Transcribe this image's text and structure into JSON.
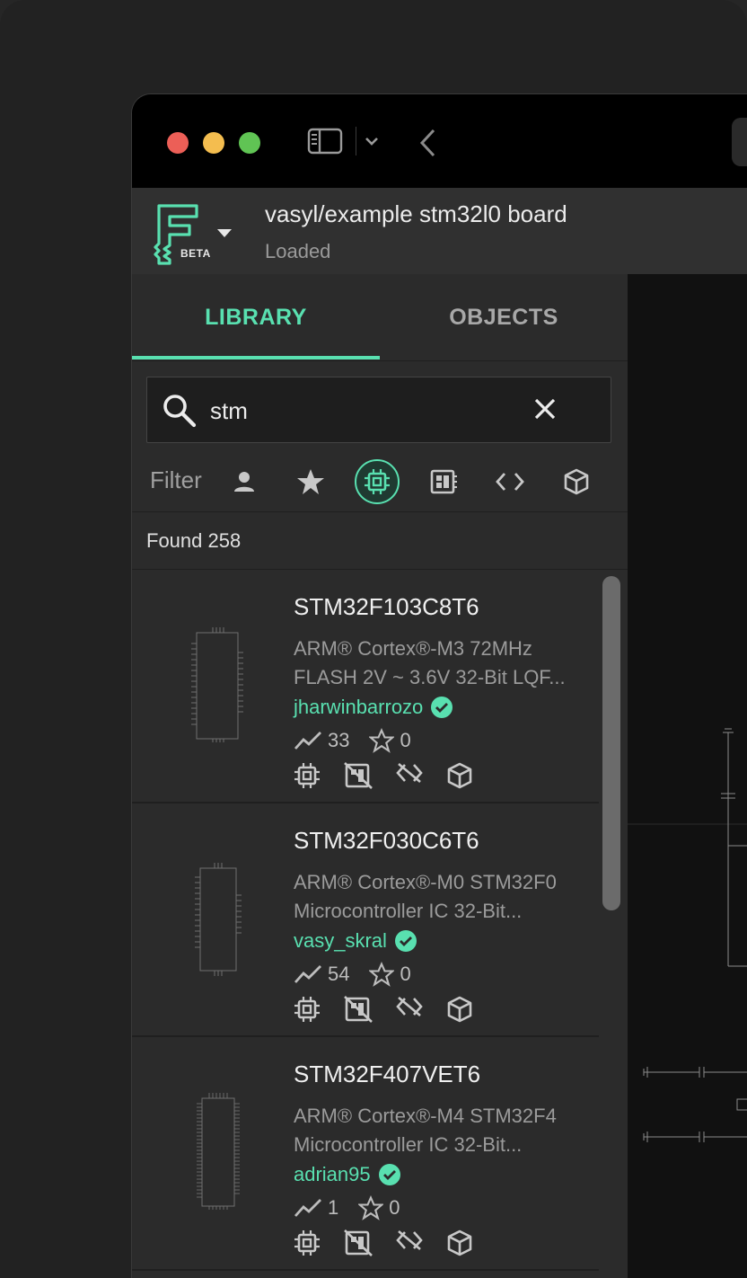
{
  "app": {
    "logo_badge": "BETA",
    "document_title": "vasyl/example stm32l0 board",
    "document_status": "Loaded"
  },
  "tabs": [
    {
      "label": "LIBRARY",
      "active": true
    },
    {
      "label": "OBJECTS",
      "active": false
    }
  ],
  "search": {
    "value": "stm",
    "placeholder": ""
  },
  "filter": {
    "label": "Filter",
    "buttons": [
      {
        "icon": "person-icon",
        "active": false
      },
      {
        "icon": "star-icon",
        "active": false
      },
      {
        "icon": "chip-icon",
        "active": true
      },
      {
        "icon": "board-icon",
        "active": false
      },
      {
        "icon": "code-icon",
        "active": false
      },
      {
        "icon": "cube-icon",
        "active": false
      }
    ]
  },
  "results": {
    "found_text": "Found 258"
  },
  "parts": [
    {
      "title": "STM32F103C8T6",
      "desc_line1": "ARM® Cortex®-M3 72MHz",
      "desc_line2": "FLASH 2V ~ 3.6V 32-Bit LQF...",
      "author": "jharwinbarrozo",
      "verified": true,
      "forks": "33",
      "stars": "0"
    },
    {
      "title": "STM32F030C6T6",
      "desc_line1": "ARM® Cortex®-M0 STM32F0",
      "desc_line2": "Microcontroller IC 32-Bit...",
      "author": "vasy_skral",
      "verified": true,
      "forks": "54",
      "stars": "0"
    },
    {
      "title": "STM32F407VET6",
      "desc_line1": "ARM® Cortex®-M4 STM32F4",
      "desc_line2": "Microcontroller IC 32-Bit...",
      "author": "adrian95",
      "verified": true,
      "forks": "1",
      "stars": "0"
    }
  ],
  "colors": {
    "accent": "#59e0b0",
    "panel_bg": "#2b2b2b",
    "appbar_bg": "#303030",
    "titlebar_bg": "#000000"
  }
}
